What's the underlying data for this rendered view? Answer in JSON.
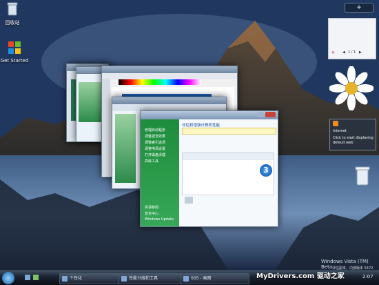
{
  "desktop": {
    "icons": [
      {
        "label": "回收站",
        "icon": "recycle-bin-icon"
      },
      {
        "label": "Get Started",
        "icon": "windows-logo-icon"
      }
    ],
    "watermark_line1": "Windows Vista (TM) Beta",
    "watermark_line2": "评估副本。内部版本 5472"
  },
  "sidebar": {
    "plus": "+",
    "nav_prev": "◀",
    "nav_next": "▶",
    "slideshow_counter": "1 / 1",
    "feed": {
      "title": "Internet",
      "message": "Click to start displaying default web"
    }
  },
  "windows": {
    "front": {
      "breadcrumb": "性能分级和工具",
      "nav_items": [
        "管理启动程序",
        "调整视觉效果",
        "调整索引选项",
        "调整电源设置",
        "打开磁盘清理",
        "高级工具"
      ],
      "heading": "评估和增强计算机性能",
      "base_score": "3",
      "footer_items": [
        "另请参阅",
        "安全中心",
        "Windows Update"
      ]
    }
  },
  "taskbar": {
    "buttons": [
      {
        "label": "个性化"
      },
      {
        "label": "性能分级和工具"
      },
      {
        "label": "005 - 画图"
      }
    ],
    "clock": "2:07"
  },
  "overlay": {
    "site_watermark": "MyDrivers.com 驱动之家"
  },
  "colors": {
    "aero_green": "#1d8c3c",
    "taskbar_dark": "#0b1018",
    "sky_blue": "#3a5a88"
  }
}
